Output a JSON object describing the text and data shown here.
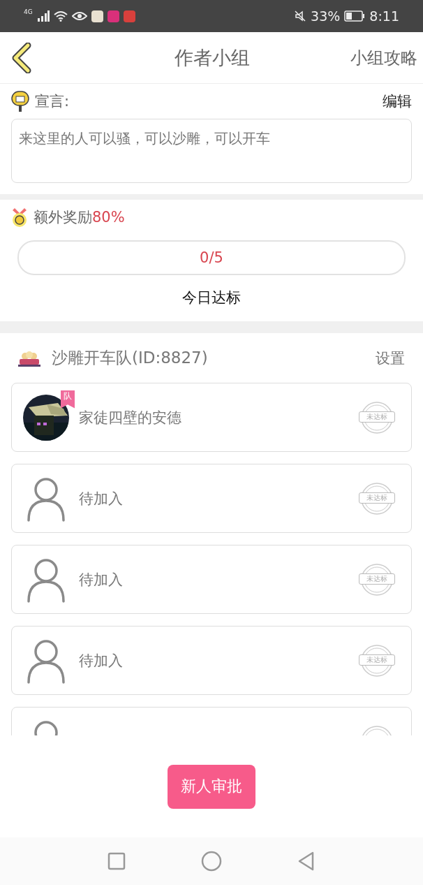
{
  "status_bar": {
    "network": "4G",
    "battery": "33%",
    "time": "8:11"
  },
  "header": {
    "title": "作者小组",
    "action": "小组攻略"
  },
  "manifesto": {
    "label": "宣言:",
    "edit": "编辑",
    "text": "来这里的人可以骚，可以沙雕，可以开车"
  },
  "reward": {
    "label": "额外奖励",
    "percent": "80%",
    "progress": "0/5",
    "level": 0,
    "caption": "今日达标"
  },
  "team": {
    "name": "沙雕开车队(ID:8827)",
    "settings": "设置"
  },
  "members": [
    {
      "kind": "member",
      "name": "家徒四壁的安德",
      "badge": "队",
      "stamp": "未达标"
    },
    {
      "kind": "empty",
      "name": "待加入",
      "stamp": "未达标"
    },
    {
      "kind": "empty",
      "name": "待加入",
      "stamp": "未达标"
    },
    {
      "kind": "empty",
      "name": "待加入",
      "stamp": "未达标"
    },
    {
      "kind": "empty"
    }
  ],
  "approve_button": "新人审批"
}
